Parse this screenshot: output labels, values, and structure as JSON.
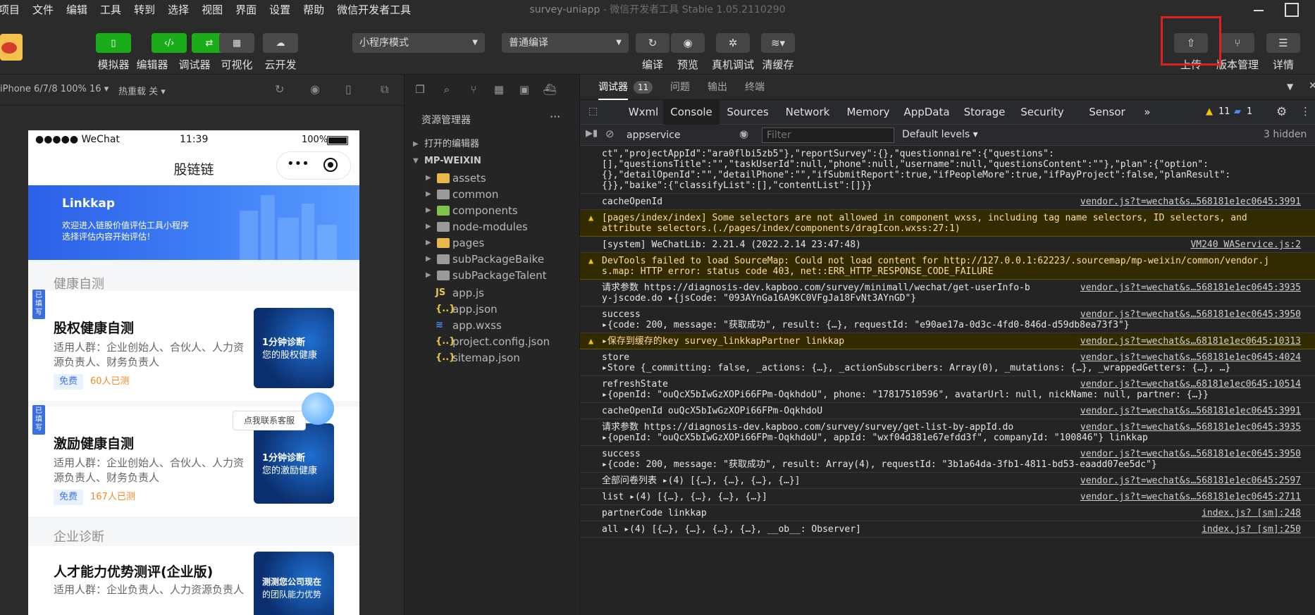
{
  "menubar": {
    "items": [
      "项目",
      "文件",
      "编辑",
      "工具",
      "转到",
      "选择",
      "视图",
      "界面",
      "设置",
      "帮助",
      "微信开发者工具"
    ],
    "title": "survey-uniapp",
    "subtitle": " - 微信开发者工具 Stable 1.05.2110290"
  },
  "toolbar": {
    "left_buttons": [
      {
        "label": "模拟器",
        "icon": "phone-icon"
      },
      {
        "label": "编辑器",
        "icon": "code-icon"
      },
      {
        "label": "调试器",
        "icon": "debug-icon"
      },
      {
        "label": "可视化",
        "icon": "layout-icon"
      },
      {
        "label": "云开发",
        "icon": "cloud-icon"
      }
    ],
    "mode_select": "小程序模式",
    "compile_select": "普通编译",
    "right_buttons": [
      {
        "label": "编译",
        "icon": "refresh-icon"
      },
      {
        "label": "预览",
        "icon": "eye-icon"
      },
      {
        "label": "真机调试",
        "icon": "bug-icon"
      },
      {
        "label": "清缓存",
        "icon": "layers-icon"
      }
    ],
    "far_right_buttons": [
      {
        "label": "上传",
        "icon": "upload-icon"
      },
      {
        "label": "版本管理",
        "icon": "branch-icon"
      },
      {
        "label": "详情",
        "icon": "menu-icon"
      }
    ]
  },
  "simulator": {
    "device": "iPhone 6/7/8 100% 16 ▾",
    "hot_reload": "热重载 关 ▾",
    "status_left": "●●●●● WeChat",
    "status_time": "11:39",
    "status_battery": "100%",
    "nav_title": "股链链",
    "banner": {
      "brand": "Linkkap",
      "line1": "欢迎进入链股价值评估工具小程序",
      "line2": "选择评估内容开始评估！"
    },
    "section1": "健康自测",
    "section2": "企业诊断",
    "tag_filled": "已填写",
    "cards": [
      {
        "title": "股权健康自测",
        "desc": "适用人群：企业创始人、合伙人、人力资源负责人、财务负责人",
        "badge": "免费",
        "count": "60人已测",
        "img1": "1分钟诊断",
        "img2": "您的股权健康"
      },
      {
        "title": "激励健康自测",
        "desc": "适用人群：企业创始人、合伙人、人力资源负责人、财务负责人",
        "badge": "免费",
        "count": "167人已测",
        "img1": "1分钟诊断",
        "img2": "您的激励健康"
      },
      {
        "title": "人才能力优势测评(企业版)",
        "desc": "适用人群：企业负责人、人力资源负责人",
        "img1": "测测您公司现在",
        "img2": "的团队能力优势"
      }
    ],
    "service_tip": "点我联系客服"
  },
  "explorer": {
    "title": "资源管理器",
    "more": "···",
    "open_editors": "打开的编辑器",
    "root": "MP-WEIXIN",
    "folders": [
      "assets",
      "common",
      "components",
      "node-modules",
      "pages",
      "subPackageBaike",
      "subPackageTalent"
    ],
    "files": [
      {
        "name": "app.js",
        "icon": "JS"
      },
      {
        "name": "app.json",
        "icon": "{..}"
      },
      {
        "name": "app.wxss",
        "icon": "≋"
      },
      {
        "name": "project.config.json",
        "icon": "{..}"
      },
      {
        "name": "sitemap.json",
        "icon": "{..}"
      }
    ]
  },
  "devtools": {
    "top_tabs": [
      "调试器",
      "问题",
      "输出",
      "终端"
    ],
    "debugger_count": "11",
    "panels": [
      "Wxml",
      "Console",
      "Sources",
      "Network",
      "Memory",
      "AppData",
      "Storage",
      "Security",
      "Sensor"
    ],
    "more_panels": "»",
    "warn_count": "11",
    "msg_count": "1",
    "context": "appservice",
    "filter_placeholder": "Filter",
    "levels": "Default levels ▾",
    "hidden": "3 hidden"
  },
  "console_logs": [
    {
      "type": "log",
      "lines": [
        "ct\",\"projectAppId\":\"ara0flbi5zb5\"},\"reportSurvey\":{},\"questionnaire\":{\"questions\":",
        "[],\"questionsTitle\":\"\",\"taskUserId\":null,\"phone\":null,\"username\":null,\"questionsContent\":\"\"},\"plan\":{\"option\":",
        "{},\"detailOpenId\":\"\",\"detailPhone\":\"\",\"ifSubmitReport\":true,\"ifPeopleMore\":true,\"ifPayProject\":false,\"planResult\":",
        "{}},\"baike\":{\"classifyList\":[],\"contentList\":[]}}"
      ],
      "src": ""
    },
    {
      "type": "log",
      "lines": [
        "cacheOpenId"
      ],
      "src": "vendor.js?t=wechat&s…568181e1ec0645:3991"
    },
    {
      "type": "warn",
      "lines": [
        "[pages/index/index] Some selectors are not allowed in component wxss, including tag name selectors, ID selectors, and",
        "attribute selectors.(./pages/index/components/dragIcon.wxss:27:1)"
      ],
      "src": ""
    },
    {
      "type": "log",
      "lines": [
        "[system] WeChatLib: 2.21.4 (2022.2.14 23:47:48)"
      ],
      "src": "VM240 WAService.js:2"
    },
    {
      "type": "warn",
      "lines": [
        "DevTools failed to load SourceMap: Could not load content for http://127.0.0.1:62223/.sourcemap/mp-weixin/common/vendor.j",
        "s.map: HTTP error: status code 403, net::ERR_HTTP_RESPONSE_CODE_FAILURE"
      ],
      "src": ""
    },
    {
      "type": "log",
      "lines": [
        "请求参数 https://diagnosis-dev.kapboo.com/survey/minimall/wechat/get-userInfo-b",
        "y-jscode.do ▸{jsCode: \"093AYnGa16A9KC0VFgJa18FvNt3AYnGD\"}"
      ],
      "src": "vendor.js?t=wechat&s…568181e1ec0645:3935"
    },
    {
      "type": "log",
      "lines": [
        "success",
        "▸{code: 200, message: \"获取成功\", result: {…}, requestId: \"e90ae17a-0d3c-4fd0-846d-d59db8ea73f3\"}"
      ],
      "src": "vendor.js?t=wechat&s…568181e1ec0645:3950"
    },
    {
      "type": "warn",
      "lines": [
        "▸保存到缓存的key survey_linkkapPartner linkkap"
      ],
      "src": "vendor.js?t=wechat&s…68181e1ec0645:10313"
    },
    {
      "type": "log",
      "lines": [
        "store",
        "▸Store {_committing: false, _actions: {…}, _actionSubscribers: Array(0), _mutations: {…}, _wrappedGetters: {…}, …}"
      ],
      "src": "vendor.js?t=wechat&s…568181e1ec0645:4024"
    },
    {
      "type": "log",
      "lines": [
        "refreshState",
        "▸{openId: \"ouQcX5bIwGzXOPi66FPm-OqkhdoU\", phone: \"17817510596\", avatarUrl: null, nickName: null, partner: {…}}"
      ],
      "src": "vendor.js?t=wechat&s…68181e1ec0645:10514"
    },
    {
      "type": "log",
      "lines": [
        "cacheOpenId ouQcX5bIwGzXOPi66FPm-OqkhdoU"
      ],
      "src": "vendor.js?t=wechat&s…568181e1ec0645:3991"
    },
    {
      "type": "log",
      "lines": [
        "请求参数 https://diagnosis-dev.kapboo.com/survey/survey/get-list-by-appId.do",
        "▸{openId: \"ouQcX5bIwGzXOPi66FPm-OqkhdoU\", appId: \"wxf04d381e67efdd3f\", companyId: \"100846\"} linkkap"
      ],
      "src": "vendor.js?t=wechat&s…568181e1ec0645:3935"
    },
    {
      "type": "log",
      "lines": [
        "success",
        "▸{code: 200, message: \"获取成功\", result: Array(4), requestId: \"3b1a64da-3fb1-4811-bd53-eaadd07ee5dc\"}"
      ],
      "src": "vendor.js?t=wechat&s…568181e1ec0645:3950"
    },
    {
      "type": "log",
      "lines": [
        "全部问卷列表 ▸(4) [{…}, {…}, {…}, {…}]"
      ],
      "src": "vendor.js?t=wechat&s…568181e1ec0645:2597"
    },
    {
      "type": "log",
      "lines": [
        "list ▸(4) [{…}, {…}, {…}, {…}]"
      ],
      "src": "vendor.js?t=wechat&s…568181e1ec0645:2711"
    },
    {
      "type": "log",
      "lines": [
        "partnerCode linkkap"
      ],
      "src": "index.js? [sm]:248"
    },
    {
      "type": "log",
      "lines": [
        "all ▸(4) [{…}, {…}, {…}, {…}, __ob__: Observer]"
      ],
      "src": "index.js? [sm]:250"
    }
  ],
  "colors": {
    "accent_green": "#1aad19",
    "highlight_red": "#e02020",
    "warn_bg": "#332b00"
  }
}
